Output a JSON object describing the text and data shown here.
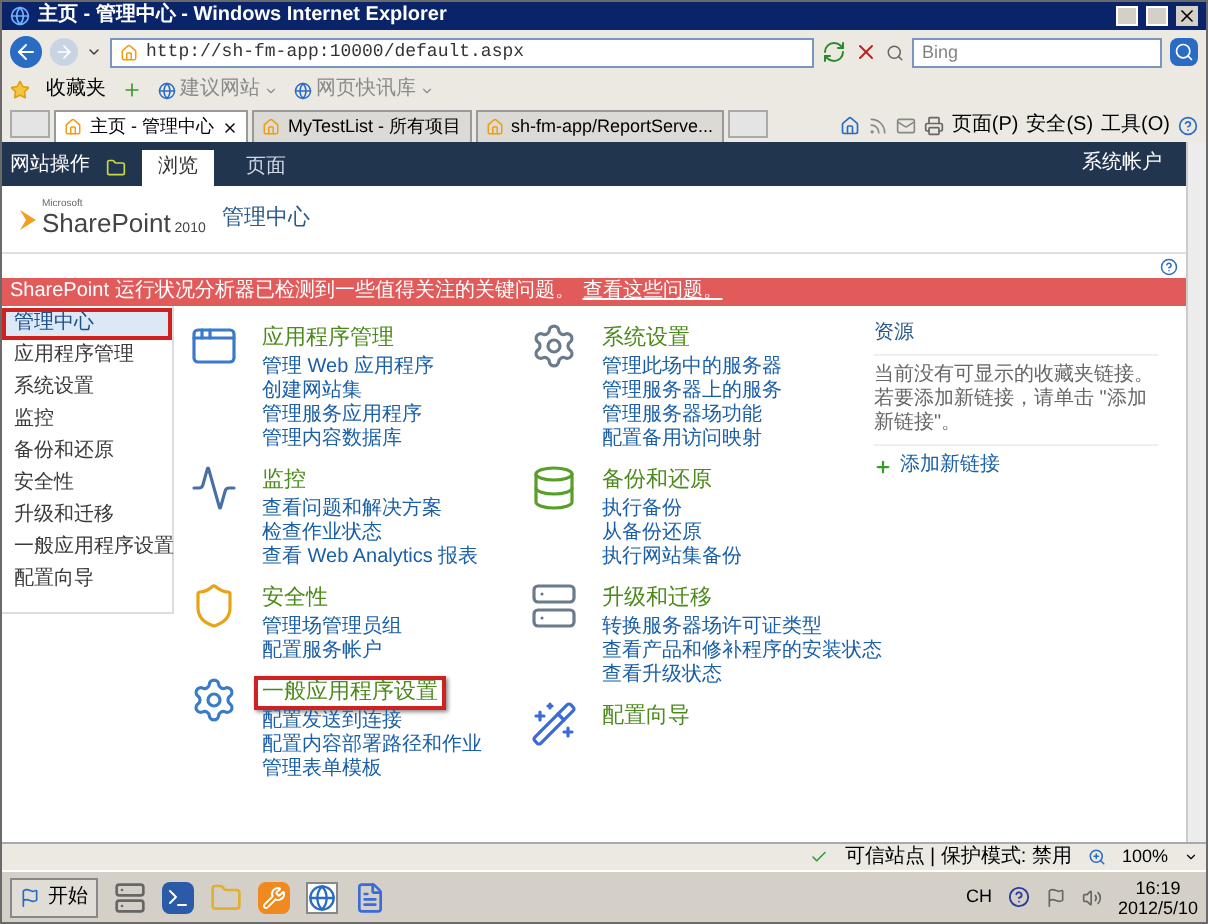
{
  "window": {
    "title": "主页 - 管理中心 - Windows Internet Explorer"
  },
  "address_bar": {
    "url": "http://sh-fm-app:10000/default.aspx",
    "search_placeholder": "Bing"
  },
  "favorites_bar": {
    "label": "收藏夹",
    "items": [
      {
        "label": "建议网站",
        "disabled": true
      },
      {
        "label": "网页快讯库",
        "disabled": true
      }
    ]
  },
  "browser_tabs": [
    {
      "label": "主页 - 管理中心",
      "selected": true
    },
    {
      "label": "MyTestList - 所有项目",
      "selected": false
    },
    {
      "label": "sh-fm-app/ReportServe...",
      "selected": false
    }
  ],
  "command_bar": [
    "页面(P)",
    "安全(S)",
    "工具(O)"
  ],
  "ribbon": {
    "site_actions": "网站操作",
    "tabs": [
      {
        "label": "浏览",
        "selected": true
      },
      {
        "label": "页面",
        "selected": false
      }
    ],
    "user": "系统帐户"
  },
  "header": {
    "logo_small": "Microsoft",
    "logo": "SharePoint",
    "logo_version": "2010",
    "site_title": "管理中心"
  },
  "alert": {
    "text": "SharePoint 运行状况分析器已检测到一些值得关注的关键问题。",
    "link": "查看这些问题。"
  },
  "nav": [
    {
      "label": "管理中心",
      "selected": true,
      "marked": true
    },
    {
      "label": "应用程序管理",
      "selected": false,
      "marked": false
    },
    {
      "label": "系统设置",
      "selected": false,
      "marked": false
    },
    {
      "label": "监控",
      "selected": false,
      "marked": false
    },
    {
      "label": "备份和还原",
      "selected": false,
      "marked": false
    },
    {
      "label": "安全性",
      "selected": false,
      "marked": false
    },
    {
      "label": "升级和迁移",
      "selected": false,
      "marked": false
    },
    {
      "label": "一般应用程序设置",
      "selected": false,
      "marked": false
    },
    {
      "label": "配置向导",
      "selected": false,
      "marked": false
    }
  ],
  "columns": [
    [
      {
        "kind": "apps",
        "title": "应用程序管理",
        "marked": false,
        "links": [
          "管理 Web 应用程序",
          "创建网站集",
          "管理服务应用程序",
          "管理内容数据库"
        ]
      },
      {
        "kind": "monitor",
        "title": "监控",
        "marked": false,
        "links": [
          "查看问题和解决方案",
          "检查作业状态",
          "查看 Web Analytics 报表"
        ]
      },
      {
        "kind": "security",
        "title": "安全性",
        "marked": false,
        "links": [
          "管理场管理员组",
          "配置服务帐户"
        ]
      },
      {
        "kind": "general",
        "title": "一般应用程序设置",
        "marked": true,
        "links": [
          "配置发送到连接",
          "配置内容部署路径和作业",
          "管理表单模板"
        ]
      }
    ],
    [
      {
        "kind": "system",
        "title": "系统设置",
        "marked": false,
        "links": [
          "管理此场中的服务器",
          "管理服务器上的服务",
          "管理服务器场功能",
          "配置备用访问映射"
        ]
      },
      {
        "kind": "backup",
        "title": "备份和还原",
        "marked": false,
        "links": [
          "执行备份",
          "从备份还原",
          "执行网站集备份"
        ]
      },
      {
        "kind": "upgrade",
        "title": "升级和迁移",
        "marked": false,
        "links": [
          "转换服务器场许可证类型",
          "查看产品和修补程序的安装状态",
          "查看升级状态"
        ]
      },
      {
        "kind": "wizard",
        "title": "配置向导",
        "marked": false
      }
    ]
  ],
  "resources": {
    "title": "资源",
    "text": "当前没有可显示的收藏夹链接。若要添加新链接，请单击 \"添加新链接\"。",
    "add_link": "添加新链接"
  },
  "status_bar": {
    "zone": "可信站点 | 保护模式: 禁用",
    "zoom": "100%"
  },
  "taskbar": {
    "start": "开始",
    "language": "CH",
    "time": "16:19",
    "date": "2012/5/10"
  }
}
